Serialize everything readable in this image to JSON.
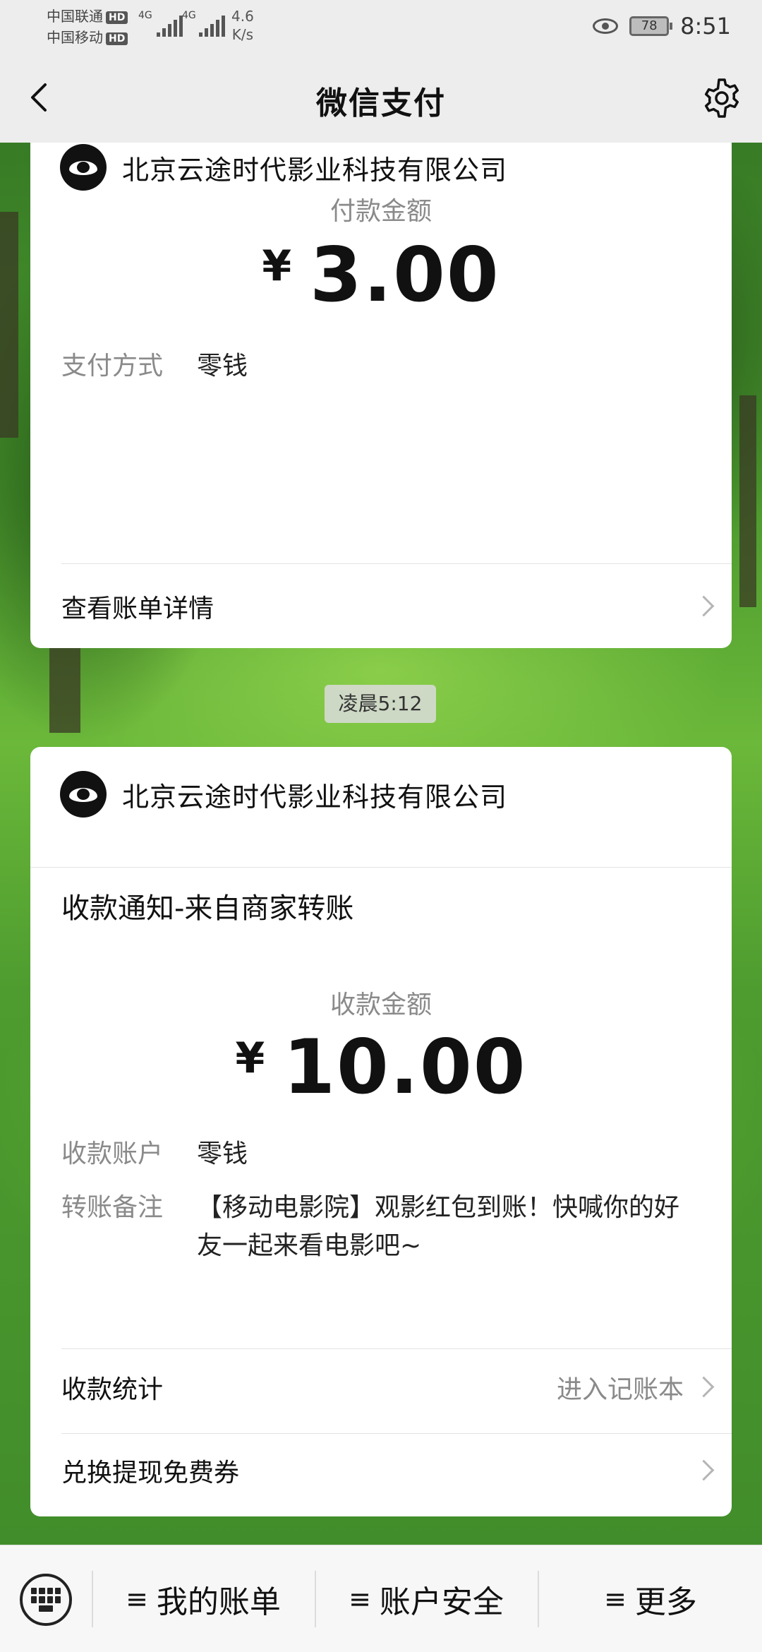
{
  "status_bar": {
    "carrier1": "中国联通",
    "carrier2": "中国移动",
    "hd_label": "HD",
    "network1": "4G",
    "network2": "4G",
    "speed_value": "4.6",
    "speed_unit": "K/s",
    "battery": "78",
    "time": "8:51"
  },
  "nav": {
    "title": "微信支付",
    "back_icon": "chevron-left-icon",
    "settings_icon": "gear-icon"
  },
  "card1": {
    "merchant": "北京云途时代影业科技有限公司",
    "amount_label": "付款金额",
    "currency": "¥",
    "amount": "3.00",
    "pay_method_label": "支付方式",
    "pay_method_value": "零钱",
    "view_bill_label": "查看账单详情"
  },
  "timestamp": "凌晨5:12",
  "card2": {
    "merchant": "北京云途时代影业科技有限公司",
    "notice_title": "收款通知-来自商家转账",
    "amount_label": "收款金额",
    "currency": "¥",
    "amount": "10.00",
    "account_label": "收款账户",
    "account_value": "零钱",
    "remark_label": "转账备注",
    "remark_value": "【移动电影院】观影红包到账！快喊你的好友一起来看电影吧~",
    "stats_label": "收款统计",
    "stats_hint": "进入记账本",
    "coupon_label": "兑换提现免费券"
  },
  "bottom_menu": {
    "keyboard_icon": "keyboard-icon",
    "items": [
      {
        "label": "我的账单"
      },
      {
        "label": "账户安全"
      },
      {
        "label": "更多"
      }
    ],
    "menu_glyph": "≡"
  }
}
